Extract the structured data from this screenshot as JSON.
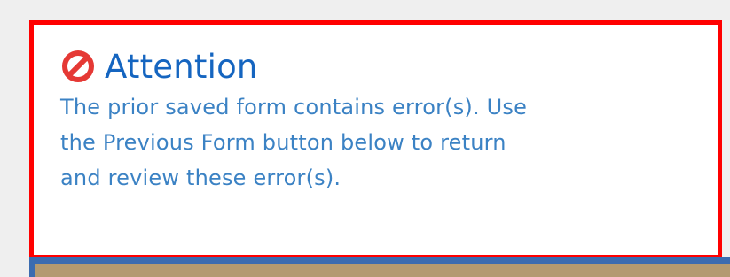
{
  "alert": {
    "title": "Attention",
    "icon": "prohibited-icon",
    "message_lines": [
      "The prior saved form contains error(s). Use",
      "the Previous Form button below to return",
      "and review these error(s)."
    ]
  },
  "colors": {
    "border": "#ff0000",
    "title": "#1565c0",
    "message": "#3b82c4",
    "icon": "#e53935",
    "strip_blue": "#3b6cb0",
    "strip_tan": "#b39a70"
  }
}
